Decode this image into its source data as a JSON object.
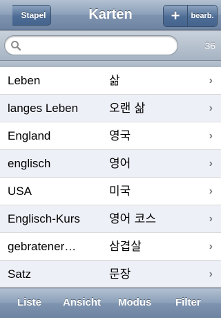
{
  "navbar": {
    "back_label": "Stapel",
    "title": "Karten",
    "add_label": "+",
    "edit_label": "bearb."
  },
  "search": {
    "value": "",
    "placeholder": "",
    "count": "36"
  },
  "rows": [
    {
      "german": "Leben",
      "korean": "삶"
    },
    {
      "german": "langes Leben",
      "korean": "오랜 삶"
    },
    {
      "german": "England",
      "korean": "영국"
    },
    {
      "german": "englisch",
      "korean": "영어"
    },
    {
      "german": "USA",
      "korean": "미국"
    },
    {
      "german": "Englisch-Kurs",
      "korean": "영어 코스"
    },
    {
      "german": "gebratener…",
      "korean": "삼겹살"
    },
    {
      "german": "Satz",
      "korean": "문장"
    }
  ],
  "toolbar": {
    "list_label": "Liste",
    "view_label": "Ansicht",
    "mode_label": "Modus",
    "filter_label": "Filter"
  },
  "colors": {
    "bar_blue": "#6d84a2",
    "row_alt": "#eef0f7"
  }
}
